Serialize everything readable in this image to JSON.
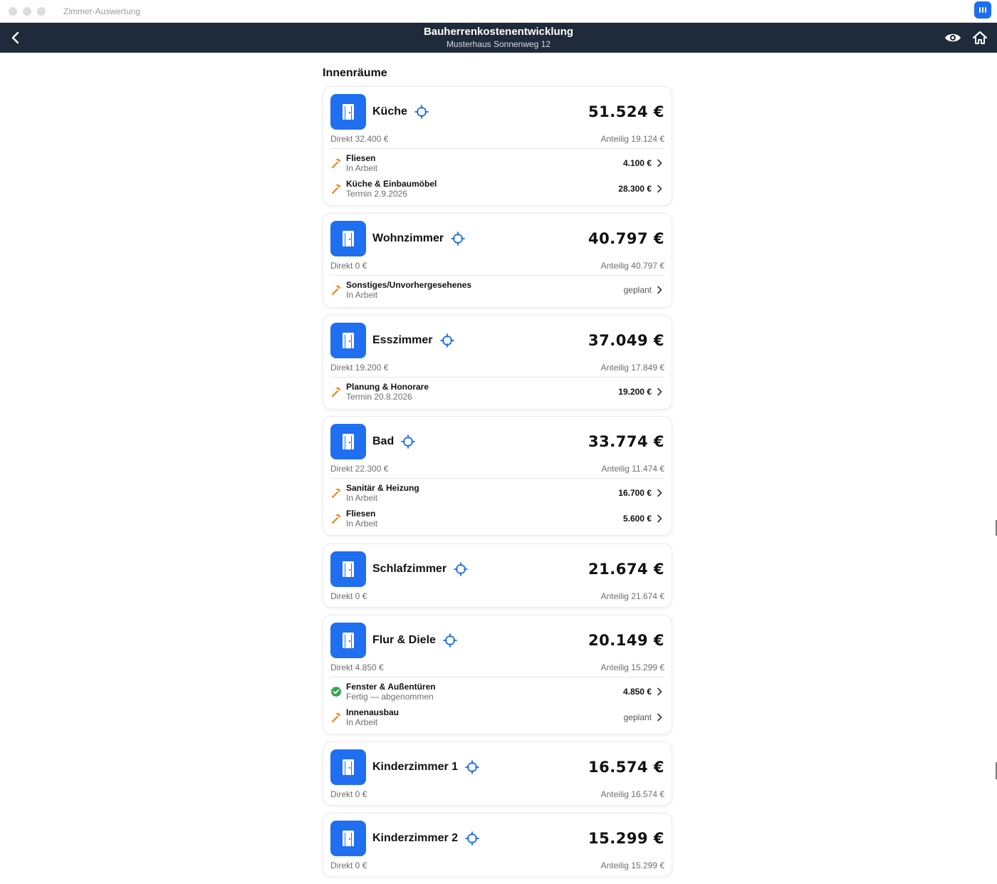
{
  "window": {
    "title": "Zimmer-Auswertung"
  },
  "nav": {
    "title": "Bauherrenkostenentwicklung",
    "subtitle": "Musterhaus Sonnenweg 12"
  },
  "section": {
    "title": "Innenräume"
  },
  "colors": {
    "accent": "#1f6ff0",
    "navbar": "#1f2a3a",
    "hammer": "#e8861c",
    "done": "#2fa84f"
  },
  "rooms": [
    {
      "name": "Küche",
      "total": "51.524 €",
      "direct": "Direkt 32.400 €",
      "share": "Anteilig 19.124 €",
      "trades": [
        {
          "name": "Fliesen",
          "status": "In Arbeit",
          "amount": "4.100 €",
          "icon": "hammer-icon"
        },
        {
          "name": "Küche & Einbaumöbel",
          "status": "Termin 2.9.2026",
          "amount": "28.300 €",
          "icon": "hammer-icon"
        }
      ]
    },
    {
      "name": "Wohnzimmer",
      "total": "40.797 €",
      "direct": "Direkt 0 €",
      "share": "Anteilig 40.797 €",
      "trades": [
        {
          "name": "Sonstiges/Unvorhergesehenes",
          "status": "In Arbeit",
          "amount": "geplant",
          "icon": "hammer-icon"
        }
      ]
    },
    {
      "name": "Esszimmer",
      "total": "37.049 €",
      "direct": "Direkt 19.200 €",
      "share": "Anteilig 17.849 €",
      "trades": [
        {
          "name": "Planung & Honorare",
          "status": "Termin 20.8.2026",
          "amount": "19.200 €",
          "icon": "hammer-icon"
        }
      ]
    },
    {
      "name": "Bad",
      "total": "33.774 €",
      "direct": "Direkt 22.300 €",
      "share": "Anteilig 11.474 €",
      "trades": [
        {
          "name": "Sanitär & Heizung",
          "status": "In Arbeit",
          "amount": "16.700 €",
          "icon": "hammer-icon"
        },
        {
          "name": "Fliesen",
          "status": "In Arbeit",
          "amount": "5.600 €",
          "icon": "hammer-icon"
        }
      ]
    },
    {
      "name": "Schlafzimmer",
      "total": "21.674 €",
      "direct": "Direkt 0 €",
      "share": "Anteilig 21.674 €",
      "trades": []
    },
    {
      "name": "Flur & Diele",
      "total": "20.149 €",
      "direct": "Direkt 4.850 €",
      "share": "Anteilig 15.299 €",
      "trades": [
        {
          "name": "Fenster & Außentüren",
          "status": "Fertig — abgenommen",
          "amount": "4.850 €",
          "icon": "checkmark-badge-icon"
        },
        {
          "name": "Innenausbau",
          "status": "In Arbeit",
          "amount": "geplant",
          "icon": "hammer-icon"
        }
      ]
    },
    {
      "name": "Kinderzimmer 1",
      "total": "16.574 €",
      "direct": "Direkt 0 €",
      "share": "Anteilig 16.574 €",
      "trades": []
    },
    {
      "name": "Kinderzimmer 2",
      "total": "15.299 €",
      "direct": "Direkt 0 €",
      "share": "Anteilig 15.299 €",
      "trades": []
    }
  ]
}
